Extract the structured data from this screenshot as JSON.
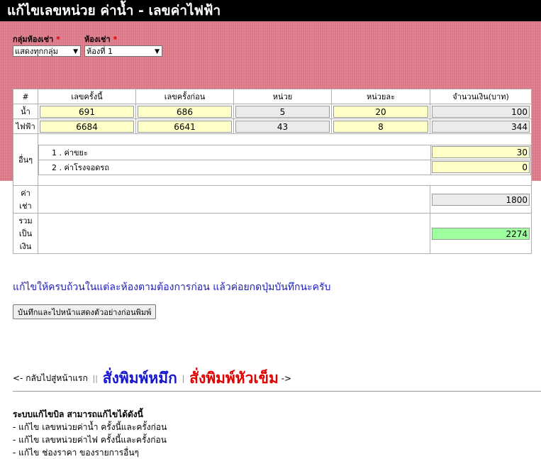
{
  "title": "แก้ไขเลขหน่วย ค่าน้ำ - เลขค่าไฟฟ้า",
  "filters": {
    "group_label": "กลุ่มห้องเช่า",
    "group_value": "แสดงทุกกลุ่ม",
    "room_label": "ห้องเช่า",
    "room_value": "ห้องที่ 1",
    "required_mark": "*",
    "dropdown_arrow": "▼"
  },
  "table": {
    "headers": [
      "#",
      "เลขครั้งนี้",
      "เลขครั้งก่อน",
      "หน่วย",
      "หน่วยละ",
      "จำนวนเงิน(บาท)"
    ],
    "water": {
      "label": "น้ำ",
      "current": "691",
      "previous": "686",
      "units": "5",
      "rate": "20",
      "amount": "100"
    },
    "electric": {
      "label": "ไฟฟ้า",
      "current": "6684",
      "previous": "6641",
      "units": "43",
      "rate": "8",
      "amount": "344"
    },
    "other": {
      "label": "อื่นๆ",
      "items": [
        {
          "name": "1 . ค่าขยะ",
          "amount": "30"
        },
        {
          "name": "2 . ค่าโรงจอดรถ",
          "amount": "0"
        }
      ]
    },
    "rent": {
      "label": "ค่าเช่า",
      "amount": "1800"
    },
    "total": {
      "label": "รวมเป็นเงิน",
      "amount": "2274"
    }
  },
  "instruction": "แก้ไขให้ครบถ้วนในแต่ละห้องตามต้องการก่อน แล้วค่อยกดปุ่มบันทึกนะครับ",
  "save_button": "บันทึกและไปหน้าแสดงตัวอย่างก่อนพิมพ์",
  "nav": {
    "back": "<- กลับไปสู่หน้าแรก",
    "sep": "||",
    "print_ink": "สั่งพิมพ์หมึก",
    "sep2": "|",
    "print_dot": "สั่งพิมพ์หัวเข็ม",
    "forward": "->"
  },
  "help": {
    "title": "ระบบแก้ไขบิล สามารถแก้ไขได้ดังนี้",
    "lines": [
      "- แก้ไข เลขหน่วยค่าน้ำ ครั้งนี้และครั้งก่อน",
      "- แก้ไข เลขหน่วยค่าไฟ ครั้งนี้และครั้งก่อน",
      "- แก้ไข ช่องราคา ของรายการอื่นๆ"
    ]
  },
  "colors": {
    "background_pink": "#e27c8c",
    "header_bg": "#000000",
    "input_yellow": "#ffffc8",
    "total_green": "#9eff9e",
    "link_blue": "#1515d0",
    "link_red": "#e00000"
  }
}
